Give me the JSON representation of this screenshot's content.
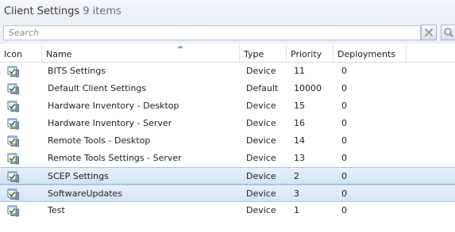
{
  "header": {
    "title": "Client Settings",
    "count": "9 items"
  },
  "search": {
    "placeholder": "Search"
  },
  "columns": {
    "icon": "Icon",
    "name": "Name",
    "type": "Type",
    "priority": "Priority",
    "deployments": "Deployments"
  },
  "rows": [
    {
      "name": "BITS Settings",
      "type": "Device",
      "priority": "11",
      "deployments": "0",
      "selected": false
    },
    {
      "name": "Default Client Settings",
      "type": "Default",
      "priority": "10000",
      "deployments": "0",
      "selected": false
    },
    {
      "name": "Hardware Inventory - Desktop",
      "type": "Device",
      "priority": "15",
      "deployments": "0",
      "selected": false
    },
    {
      "name": "Hardware Inventory - Server",
      "type": "Device",
      "priority": "16",
      "deployments": "0",
      "selected": false
    },
    {
      "name": "Remote Tools - Desktop",
      "type": "Device",
      "priority": "14",
      "deployments": "0",
      "selected": false
    },
    {
      "name": "Remote Tools Settings - Server",
      "type": "Device",
      "priority": "13",
      "deployments": "0",
      "selected": false
    },
    {
      "name": "SCEP Settings",
      "type": "Device",
      "priority": "2",
      "deployments": "0",
      "selected": true
    },
    {
      "name": "SoftwareUpdates",
      "type": "Device",
      "priority": "3",
      "deployments": "0",
      "selected": true
    },
    {
      "name": "Test",
      "type": "Device",
      "priority": "1",
      "deployments": "0",
      "selected": false
    }
  ],
  "icons": {
    "row": "client-settings-icon",
    "clear": "clear-x-icon",
    "search": "magnifier-icon",
    "sort": "sort-ascending-icon"
  },
  "colors": {
    "selection_fill": "#dbe8f7",
    "selection_border": "#a9c3e2",
    "header_bg": "#eef1f5"
  }
}
